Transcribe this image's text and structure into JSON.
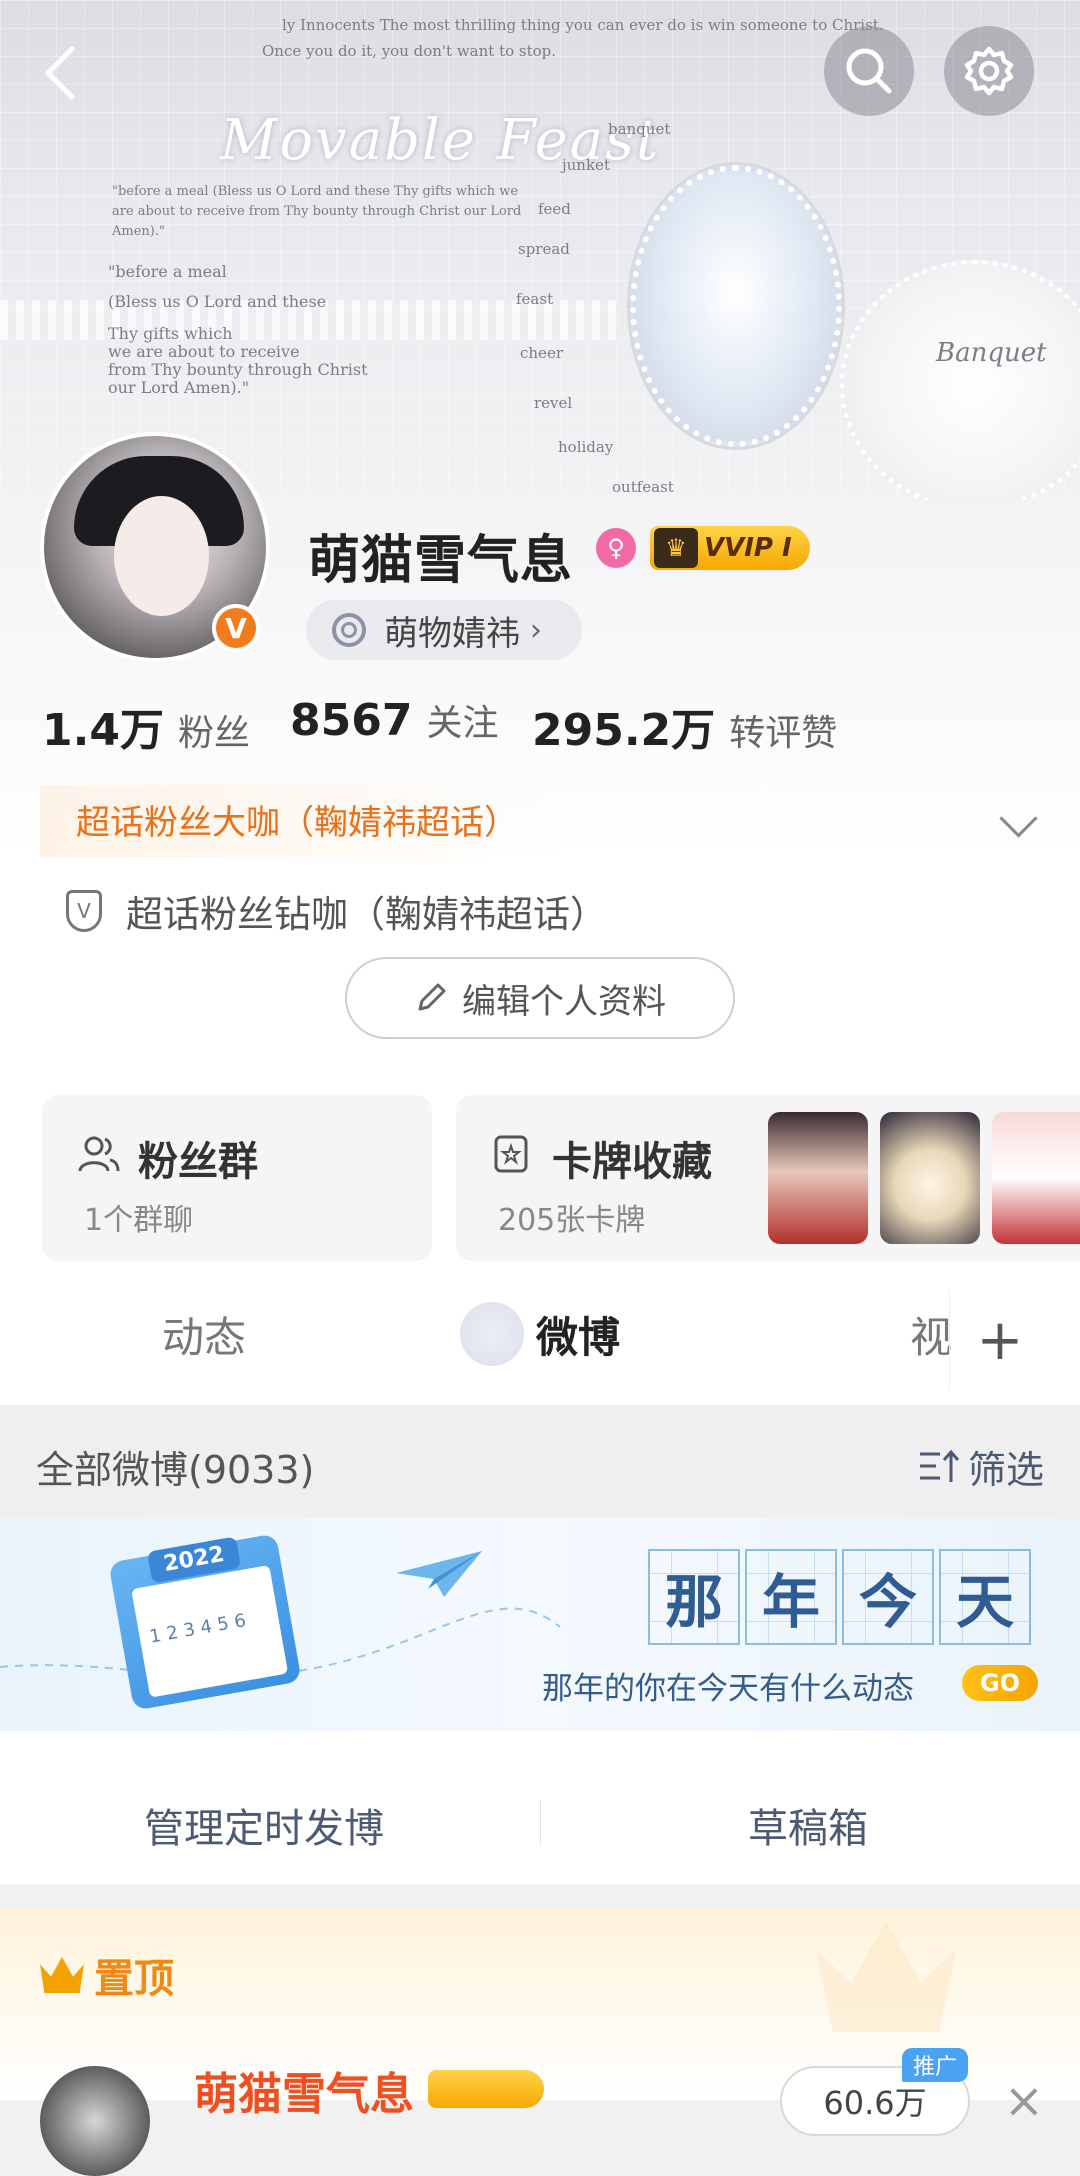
{
  "header": {
    "banner_title": "Movable Feast",
    "banner_quote_top": "ly Innocents The most thrilling thing you can ever do is win someone to Christ.",
    "banner_quote_top2": "Once you do it, you don't want to stop.",
    "banner_prayer_small": "\"before a meal (Bless us O Lord and these Thy gifts which we are about to receive from Thy bounty through Christ our Lord Amen).\"",
    "banner_prayer_lines": [
      "\"before a meal",
      "(Bless us O Lord and these",
      "Thy gifts which",
      "we are about to receive",
      "from Thy bounty through Christ",
      "our Lord Amen).\""
    ],
    "banner_words": [
      "banquet",
      "junket",
      "feed",
      "spread",
      "feast",
      "cheer",
      "revel",
      "holiday",
      "outfeast"
    ],
    "banner_banquet": "Banquet",
    "back_icon": "back-arrow-icon",
    "search_icon": "search-icon",
    "settings_icon": "gear-icon"
  },
  "profile": {
    "name": "萌猫雪气息",
    "gender_icon": "female-icon",
    "vip_label": "VVIP I",
    "verified_badge": "V",
    "tag": "萌物婧祎",
    "stats": [
      {
        "num": "1.4万",
        "label": "粉丝"
      },
      {
        "num": "8567",
        "label": "关注"
      },
      {
        "num": "295.2万",
        "label": "转评赞"
      }
    ],
    "fan_title_primary": "超话粉丝大咖（鞠婧祎超话）",
    "fan_title_secondary": "超话粉丝钻咖（鞠婧祎超话）",
    "edit_button": "编辑个人资料"
  },
  "cards": {
    "fan_group": {
      "title": "粉丝群",
      "sub": "1个群聊"
    },
    "card_collection": {
      "title": "卡牌收藏",
      "sub": "205张卡牌"
    }
  },
  "tabs": {
    "items": [
      "动态",
      "微博",
      "视"
    ],
    "active": "微博",
    "add": "+"
  },
  "feed": {
    "filter_label": "全部微博(9033)",
    "filter_button": "筛选",
    "memory": {
      "chars": [
        "那",
        "年",
        "今",
        "天"
      ],
      "subtitle": "那年的你在今天有什么动态",
      "go": "GO",
      "calendar_year": "2022",
      "calendar_days": "1 2 3 4 5 6"
    },
    "actions": [
      "管理定时发博",
      "草稿箱"
    ],
    "pinned_label": "置顶",
    "post_author": "萌猫雪气息",
    "post_follow": "60.6万",
    "post_promo": "推广"
  },
  "colors": {
    "accent_orange": "#f27c1c",
    "link_blue": "#4c5a73",
    "vip_gold": "#f5a800",
    "pink": "#f06aa5"
  }
}
